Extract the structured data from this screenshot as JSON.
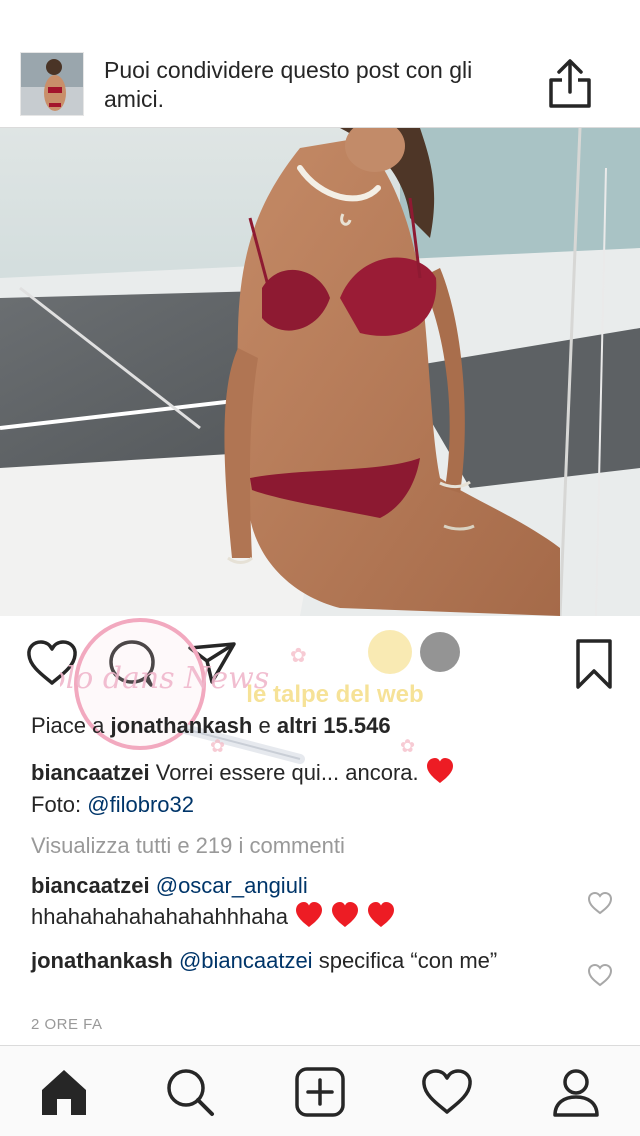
{
  "share_banner": {
    "text": "Puoi condividere questo post con gli amici.",
    "icon": "share-icon"
  },
  "post": {
    "likes_prefix": "Piace a",
    "liked_by": "jonathankash",
    "likes_connector": "e",
    "likes_others": "altri 15.546",
    "caption": {
      "username": "biancaatzei",
      "text": "Vorrei essere qui... ancora.",
      "emoji": "red-heart",
      "photo_credit_label": "Foto:",
      "photo_credit_mention": "@filobro32"
    },
    "view_all_comments": "Visualizza tutti e 219 i commenti",
    "comments": [
      {
        "username": "biancaatzei",
        "mention": "@oscar_angiuli",
        "text": "hhahahahahahahahhhaha",
        "emoji_count": 3
      },
      {
        "username": "jonathankash",
        "mention": "@biancaatzei",
        "text": "specifica “con me”"
      }
    ],
    "timestamp": "2 ORE FA"
  },
  "watermarks": {
    "left": "Vaolo dans News",
    "right": "le talpe del web"
  },
  "actions": [
    "heart-icon",
    "comment-icon",
    "send-icon",
    "bookmark-icon"
  ],
  "tab_bar": [
    "home-icon",
    "search-icon",
    "add-post-icon",
    "activity-heart-icon",
    "profile-icon"
  ],
  "colors": {
    "text": "#262626",
    "muted": "#999999",
    "mention": "#003569",
    "heart_red": "#ed1c24"
  }
}
